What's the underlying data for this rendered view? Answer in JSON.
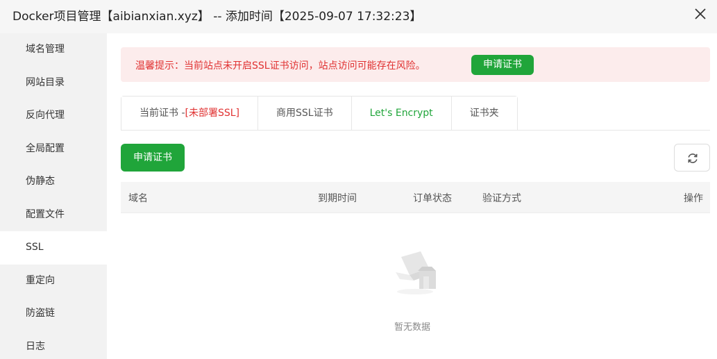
{
  "window": {
    "title": "Docker项目管理【aibianxian.xyz】 -- 添加时间【2025-09-07 17:32:23】"
  },
  "sidebar": {
    "items": [
      {
        "label": "域名管理"
      },
      {
        "label": "网站目录"
      },
      {
        "label": "反向代理"
      },
      {
        "label": "全局配置"
      },
      {
        "label": "伪静态"
      },
      {
        "label": "配置文件"
      },
      {
        "label": "SSL",
        "active": true
      },
      {
        "label": "重定向"
      },
      {
        "label": "防盗链"
      },
      {
        "label": "日志"
      }
    ]
  },
  "alert": {
    "text": "温馨提示：当前站点未开启SSL证书访问，站点访问可能存在风险。",
    "button": "申请证书"
  },
  "tabs": {
    "current_prefix": "当前证书 -",
    "current_status": "[未部署SSL]",
    "commercial": "商用SSL证书",
    "letsencrypt": "Let's Encrypt",
    "folder": "证书夹"
  },
  "toolbar": {
    "apply_label": "申请证书"
  },
  "table": {
    "columns": [
      "域名",
      "到期时间",
      "订单状态",
      "验证方式",
      "操作"
    ],
    "rows": [],
    "empty_text": "暂无数据"
  },
  "colors": {
    "accent": "#20a53a",
    "danger": "#e03131",
    "alert_bg": "#fcecec"
  },
  "icons": [
    "close-icon",
    "refresh-icon",
    "empty-box-icon"
  ]
}
